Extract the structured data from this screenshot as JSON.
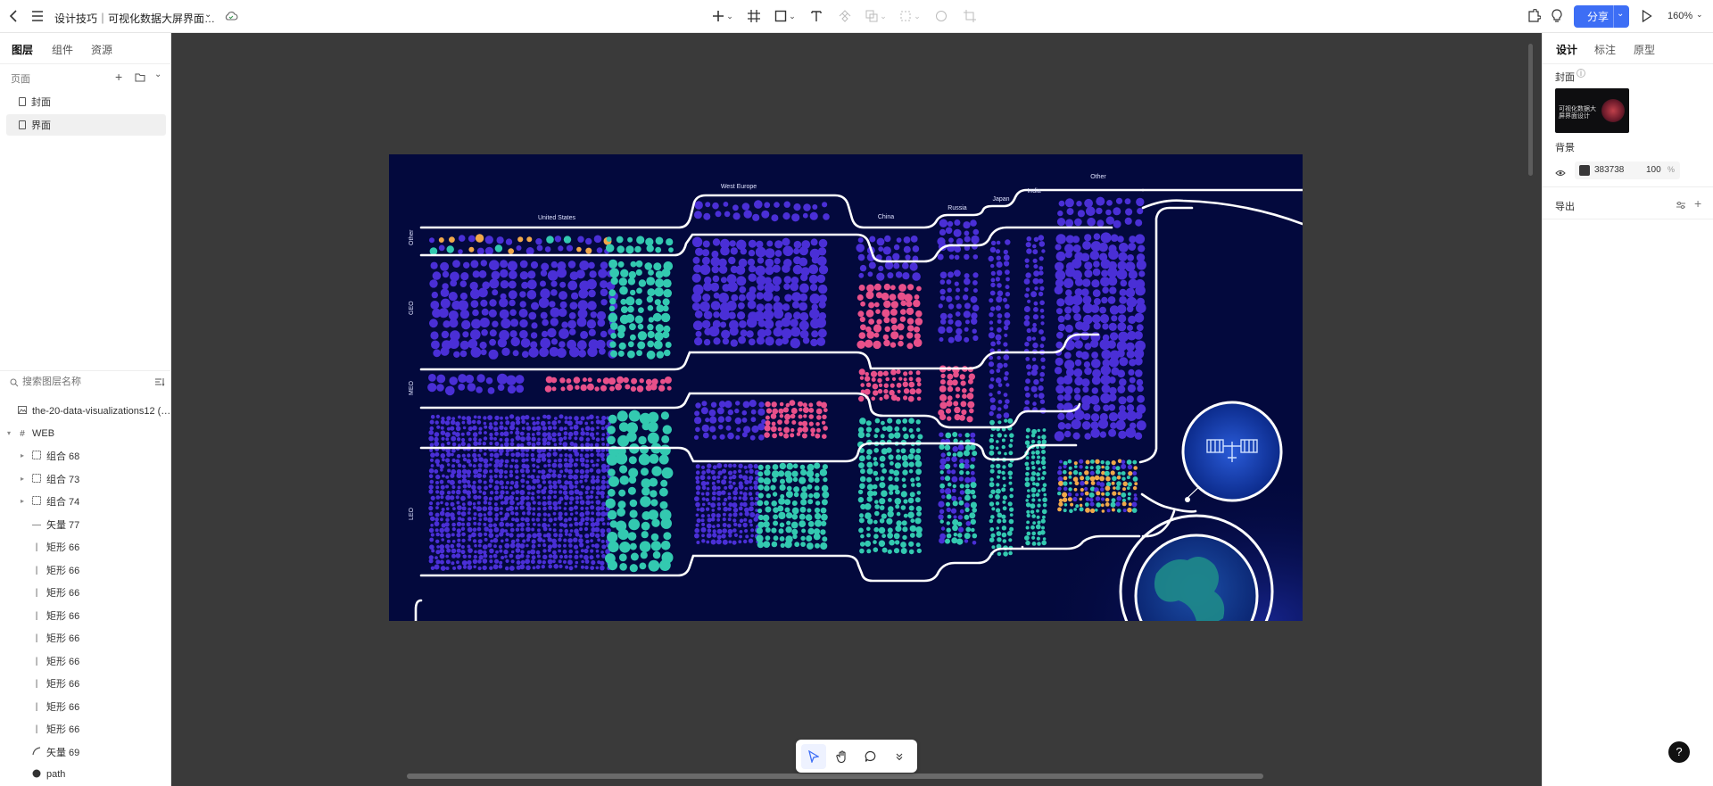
{
  "header": {
    "title": "设计技巧｜可视化数据大屏界面…",
    "share_label": "分享",
    "zoom": "160%"
  },
  "left": {
    "tabs": [
      "图层",
      "组件",
      "资源"
    ],
    "pages_label": "页面",
    "pages": [
      "封面",
      "界面"
    ],
    "search_placeholder": "搜索图层名称",
    "layers": [
      {
        "label": "the-20-data-visualizations12 (…",
        "icon": "image-icon"
      },
      {
        "label": "WEB",
        "icon": "frame-icon"
      },
      {
        "label": "组合 68",
        "icon": "group-icon"
      },
      {
        "label": "组合 73",
        "icon": "group-icon"
      },
      {
        "label": "组合 74",
        "icon": "group-icon"
      },
      {
        "label": "矢量 77",
        "icon": "vector-line-icon"
      },
      {
        "label": "矩形 66",
        "icon": "rect-line-icon"
      },
      {
        "label": "矩形 66",
        "icon": "rect-line-icon"
      },
      {
        "label": "矩形 66",
        "icon": "rect-line-icon"
      },
      {
        "label": "矩形 66",
        "icon": "rect-line-icon"
      },
      {
        "label": "矩形 66",
        "icon": "rect-line-icon"
      },
      {
        "label": "矩形 66",
        "icon": "rect-line-icon"
      },
      {
        "label": "矩形 66",
        "icon": "rect-line-icon"
      },
      {
        "label": "矩形 66",
        "icon": "rect-line-icon"
      },
      {
        "label": "矩形 66",
        "icon": "rect-line-icon"
      },
      {
        "label": "矢量 69",
        "icon": "vector-curve-icon"
      },
      {
        "label": "path",
        "icon": "path-icon"
      }
    ]
  },
  "right": {
    "tabs": [
      "设计",
      "标注",
      "原型"
    ],
    "cover_label": "封面",
    "cover_thumb_text": "可视化数据大屏界面设计",
    "background_label": "背景",
    "bg_hex": "383738",
    "bg_opacity": "100",
    "bg_opacity_unit": "%",
    "export_label": "导出"
  },
  "artboard": {
    "columns": [
      "United States",
      "West Europe",
      "China",
      "Russia",
      "Japan",
      "India",
      "Other"
    ],
    "rows": [
      "Other",
      "GEO",
      "MEO",
      "LEO"
    ]
  },
  "colors": {
    "accent": "#3d6ef5",
    "artboard_bg": "#03093d",
    "purple": "#4a2fd6",
    "teal": "#33c9b0",
    "pink": "#e8508a",
    "orange": "#f0a84a"
  }
}
